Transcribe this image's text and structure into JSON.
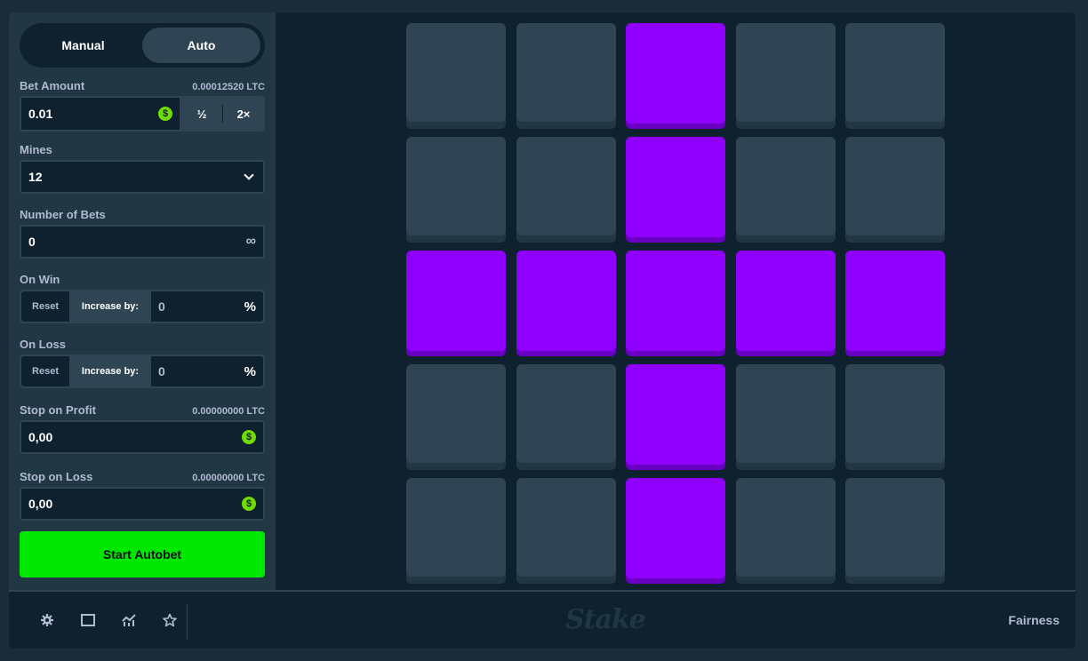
{
  "mode": {
    "manual_label": "Manual",
    "auto_label": "Auto",
    "active": "Auto"
  },
  "bet": {
    "label": "Bet Amount",
    "crypto_value": "0.00012520 LTC",
    "value": "0.01",
    "currency_icon": "$",
    "half_label": "½",
    "double_label": "2×"
  },
  "mines": {
    "label": "Mines",
    "value": "12"
  },
  "number_of_bets": {
    "label": "Number of Bets",
    "value": "0",
    "infinity_icon": "∞"
  },
  "on_win": {
    "label": "On Win",
    "reset_label": "Reset",
    "increase_label": "Increase by:",
    "value": "0",
    "unit": "%"
  },
  "on_loss": {
    "label": "On Loss",
    "reset_label": "Reset",
    "increase_label": "Increase by:",
    "value": "0",
    "unit": "%"
  },
  "stop_on_profit": {
    "label": "Stop on Profit",
    "crypto_value": "0.00000000 LTC",
    "value": "0,00",
    "currency_icon": "$"
  },
  "stop_on_loss": {
    "label": "Stop on Loss",
    "crypto_value": "0.00000000 LTC",
    "value": "0,00",
    "currency_icon": "$"
  },
  "start_button": {
    "label": "Start Autobet"
  },
  "grid": {
    "rows": 5,
    "cols": 5,
    "selected": [
      [
        false,
        false,
        true,
        false,
        false
      ],
      [
        false,
        false,
        true,
        false,
        false
      ],
      [
        true,
        true,
        true,
        true,
        true
      ],
      [
        false,
        false,
        true,
        false,
        false
      ],
      [
        false,
        false,
        true,
        false,
        false
      ]
    ],
    "colors": {
      "tile": "#2f4553",
      "selected": "#9000ff"
    }
  },
  "footer": {
    "icons": [
      "gear-icon",
      "square-icon",
      "stats-icon",
      "star-icon"
    ],
    "logo": "Stake",
    "fairness_label": "Fairness"
  },
  "colors": {
    "accent_green": "#00e701",
    "bg_dark": "#0f212e",
    "panel": "#213743"
  }
}
